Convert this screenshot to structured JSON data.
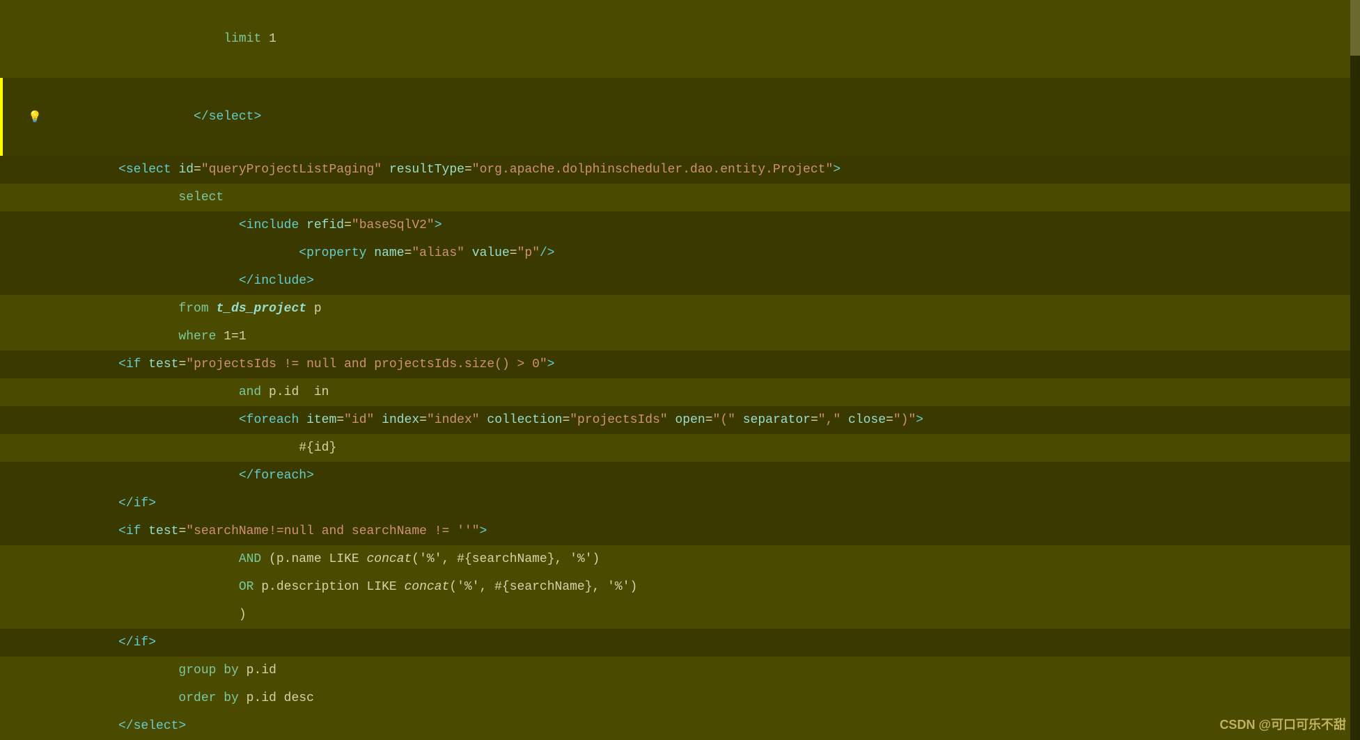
{
  "editor": {
    "background": "#4a4a00",
    "lines": [
      {
        "id": 1,
        "indent": 2,
        "content_html": "<span class='sql-kw'>limit</span> <span class='normal'>1</span>",
        "highlight": false,
        "has_indicator": false
      },
      {
        "id": 2,
        "indent": 1,
        "content_html": "<span class='tag-bracket'>&lt;/</span><span class='tag-name'>select</span><span class='tag-bracket'>&gt;</span>",
        "highlight": false,
        "has_indicator": true,
        "has_bulb": true
      },
      {
        "id": 3,
        "indent": 0,
        "content_html": "<span class='tag-bracket'>&lt;</span><span class='tag-name'>select</span> <span class='attr-key'>id</span><span class='eq'>=</span><span class='string-val'>\"queryProjectListPaging\"</span> <span class='attr-key'>resultType</span><span class='eq'>=</span><span class='string-val'>\"org.apache.dolphinscheduler.dao.entity.Project\"</span><span class='tag-bracket'>&gt;</span>",
        "highlight": true,
        "highlight_type": "dark"
      },
      {
        "id": 4,
        "indent": 1,
        "content_html": "<span class='sql-kw'>select</span>",
        "highlight": false
      },
      {
        "id": 5,
        "indent": 2,
        "content_html": "<span class='tag-bracket'>&lt;</span><span class='tag-name'>include</span> <span class='attr-key'>refid</span><span class='eq'>=</span><span class='string-val'>\"baseSqlV2\"</span><span class='tag-bracket'>&gt;</span>",
        "highlight": true,
        "highlight_type": "dark"
      },
      {
        "id": 6,
        "indent": 3,
        "content_html": "<span class='tag-bracket'>&lt;</span><span class='tag-name'>property</span> <span class='attr-key'>name</span><span class='eq'>=</span><span class='string-val'>\"alias\"</span> <span class='attr-key'>value</span><span class='eq'>=</span><span class='string-val'>\"p\"</span><span class='tag-bracket'>/&gt;</span>",
        "highlight": true,
        "highlight_type": "dark"
      },
      {
        "id": 7,
        "indent": 2,
        "content_html": "<span class='tag-bracket'>&lt;/</span><span class='tag-name'>include</span><span class='tag-bracket'>&gt;</span>",
        "highlight": true,
        "highlight_type": "dark"
      },
      {
        "id": 8,
        "indent": 1,
        "content_html": "<span class='sql-kw'>from</span> <span class='sql-alias'>t_ds_project</span> <span class='normal'>p</span>",
        "highlight": false
      },
      {
        "id": 9,
        "indent": 1,
        "content_html": "<span class='sql-kw'>where</span> <span class='normal'>1=1</span>",
        "highlight": false
      },
      {
        "id": 10,
        "indent": 0,
        "content_html": "<span class='tag-bracket'>&lt;</span><span class='tag-name'>if</span> <span class='attr-key'>test</span><span class='eq'>=</span><span class='string-val'>\"projectsIds != null and projectsIds.size() &gt; 0\"</span><span class='tag-bracket'>&gt;</span>",
        "highlight": true,
        "highlight_type": "dark"
      },
      {
        "id": 11,
        "indent": 2,
        "content_html": "<span class='sql-kw'>and</span> <span class='normal'>p.id  in</span>",
        "highlight": false
      },
      {
        "id": 12,
        "indent": 2,
        "content_html": "<span class='tag-bracket'>&lt;</span><span class='tag-name'>foreach</span> <span class='attr-key'>item</span><span class='eq'>=</span><span class='string-val'>\"id\"</span> <span class='attr-key'>index</span><span class='eq'>=</span><span class='string-val'>\"index\"</span> <span class='attr-key'>collection</span><span class='eq'>=</span><span class='string-val'>\"projectsIds\"</span> <span class='attr-key'>open</span><span class='eq'>=</span><span class='string-val'>\"(\"</span> <span class='attr-key'>separator</span><span class='eq'>=</span><span class='string-val'>\",\"</span> <span class='attr-key'>close</span><span class='eq'>=</span><span class='string-val'>\")\"</span><span class='tag-bracket'>&gt;</span>",
        "highlight": true,
        "highlight_type": "dark"
      },
      {
        "id": 13,
        "indent": 3,
        "content_html": "<span class='normal'>#{id}</span>",
        "highlight": false
      },
      {
        "id": 14,
        "indent": 2,
        "content_html": "<span class='tag-bracket'>&lt;/</span><span class='tag-name'>foreach</span><span class='tag-bracket'>&gt;</span>",
        "highlight": true,
        "highlight_type": "dark"
      },
      {
        "id": 15,
        "indent": 0,
        "content_html": "<span class='tag-bracket'>&lt;/</span><span class='tag-name'>if</span><span class='tag-bracket'>&gt;</span>",
        "highlight": true,
        "highlight_type": "dark"
      },
      {
        "id": 16,
        "indent": 0,
        "content_html": "<span class='tag-bracket'>&lt;</span><span class='tag-name'>if</span> <span class='attr-key'>test</span><span class='eq'>=</span><span class='string-val'>\"searchName!=null and searchName != ''\"</span><span class='tag-bracket'>&gt;</span>",
        "highlight": true,
        "highlight_type": "dark"
      },
      {
        "id": 17,
        "indent": 2,
        "content_html": "<span class='sql-kw'>AND</span> <span class='normal'>(p.name LIKE <em>concat</em>('%', #{searchName}, '%')</span>",
        "highlight": false
      },
      {
        "id": 18,
        "indent": 2,
        "content_html": "<span class='sql-kw'>OR</span> <span class='normal'>p.description LIKE <em>concat</em>('%', #{searchName}, '%')</span>",
        "highlight": false
      },
      {
        "id": 19,
        "indent": 2,
        "content_html": "<span class='normal'>)</span>",
        "highlight": false
      },
      {
        "id": 20,
        "indent": 0,
        "content_html": "<span class='tag-bracket'>&lt;/</span><span class='tag-name'>if</span><span class='tag-bracket'>&gt;</span>",
        "highlight": true,
        "highlight_type": "dark"
      },
      {
        "id": 21,
        "indent": 1,
        "content_html": "<span class='sql-kw'>group</span> <span class='sql-kw'>by</span> <span class='normal'>p.id</span>",
        "highlight": false
      },
      {
        "id": 22,
        "indent": 1,
        "content_html": "<span class='sql-kw'>order</span> <span class='sql-kw'>by</span> <span class='normal'>p.id desc</span>",
        "highlight": false
      },
      {
        "id": 23,
        "indent": 0,
        "content_html": "<span class='tag-bracket'>&lt;/</span><span class='tag-name'>select</span><span class='tag-bracket'>&gt;</span>",
        "highlight": false
      }
    ],
    "watermark": "CSDN @可口可乐不甜"
  }
}
